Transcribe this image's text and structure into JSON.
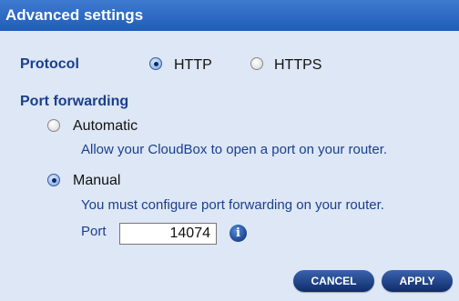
{
  "header": {
    "title": "Advanced settings"
  },
  "protocol": {
    "label": "Protocol",
    "options": [
      {
        "label": "HTTP",
        "checked": true
      },
      {
        "label": "HTTPS",
        "checked": false
      }
    ]
  },
  "port_forwarding": {
    "label": "Port forwarding",
    "automatic": {
      "label": "Automatic",
      "checked": false,
      "description": "Allow your CloudBox to open a port on your router."
    },
    "manual": {
      "label": "Manual",
      "checked": true,
      "description": "You must configure port forwarding on your router."
    },
    "port": {
      "label": "Port",
      "value": "14074"
    },
    "info_icon": "info-icon"
  },
  "buttons": {
    "cancel": "CANCEL",
    "apply": "APPLY"
  },
  "colors": {
    "header": "#2a67c4",
    "background": "#dde7f5",
    "accent_text": "#1b3f8f",
    "button": "#0f2b6a"
  }
}
